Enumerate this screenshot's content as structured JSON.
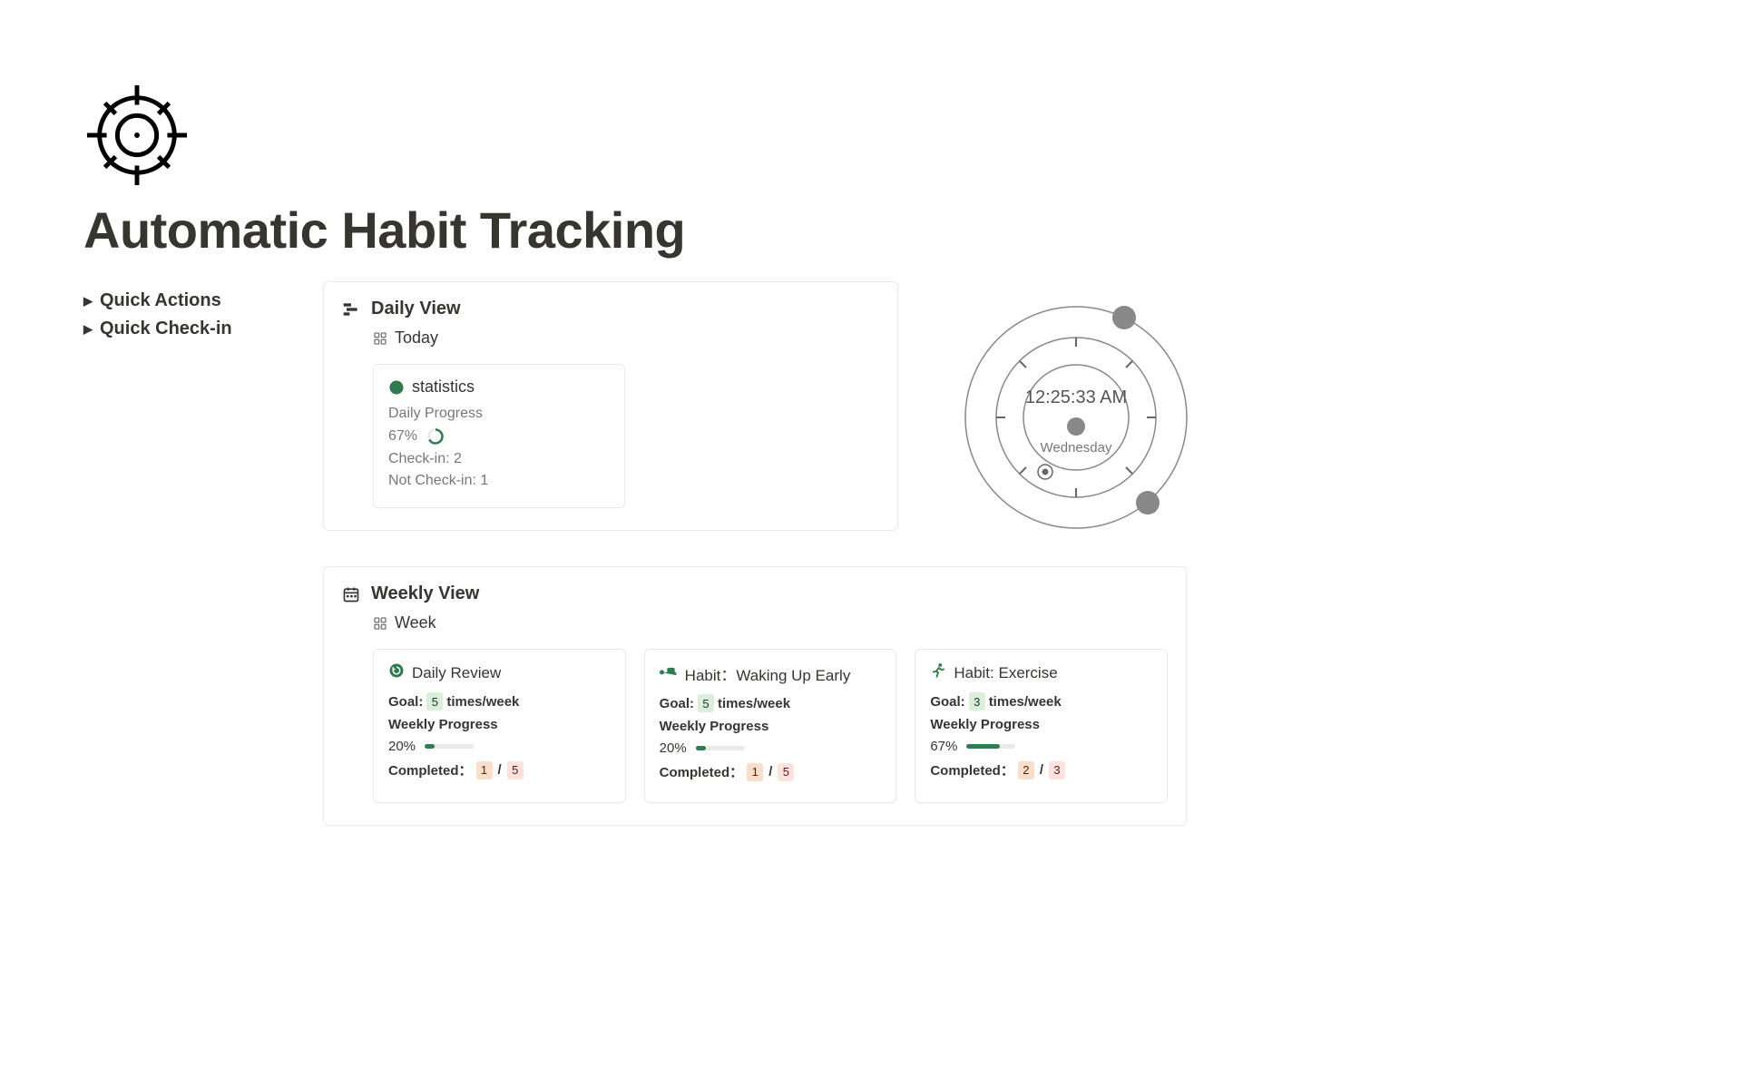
{
  "page": {
    "title": "Automatic Habit Tracking"
  },
  "sidebar": {
    "toggles": [
      {
        "label": "Quick Actions"
      },
      {
        "label": "Quick Check-in"
      }
    ]
  },
  "daily": {
    "header": "Daily View",
    "view_label": "Today",
    "stats": {
      "title": "statistics",
      "progress_label": "Daily Progress",
      "pct_text": "67%",
      "pct_value": 67,
      "checkin": "Check-in: 2",
      "not_checkin": "Not Check-in: 1"
    }
  },
  "clock": {
    "time": "12:25:33 AM",
    "day": "Wednesday"
  },
  "weekly": {
    "header": "Weekly View",
    "view_label": "Week",
    "cards": [
      {
        "icon": "review",
        "title": "Daily Review",
        "goal_prefix": "Goal:",
        "goal_value": "5",
        "goal_suffix": "times/week",
        "progress_label": "Weekly Progress",
        "pct_text": "20%",
        "pct_value": 20,
        "completed_prefix": "Completed：",
        "done": "1",
        "target": "5",
        "target_color": "red"
      },
      {
        "icon": "bed",
        "title": "Habit：Waking Up Early",
        "goal_prefix": "Goal:",
        "goal_value": "5",
        "goal_suffix": "times/week",
        "progress_label": "Weekly Progress",
        "pct_text": "20%",
        "pct_value": 20,
        "completed_prefix": "Completed：",
        "done": "1",
        "target": "5",
        "target_color": "red"
      },
      {
        "icon": "run",
        "title": "Habit: Exercise",
        "goal_prefix": "Goal:",
        "goal_value": "3",
        "goal_suffix": "times/week",
        "progress_label": "Weekly Progress",
        "pct_text": "67%",
        "pct_value": 67,
        "completed_prefix": "Completed：",
        "done": "2",
        "target": "3",
        "target_color": "red"
      }
    ]
  }
}
